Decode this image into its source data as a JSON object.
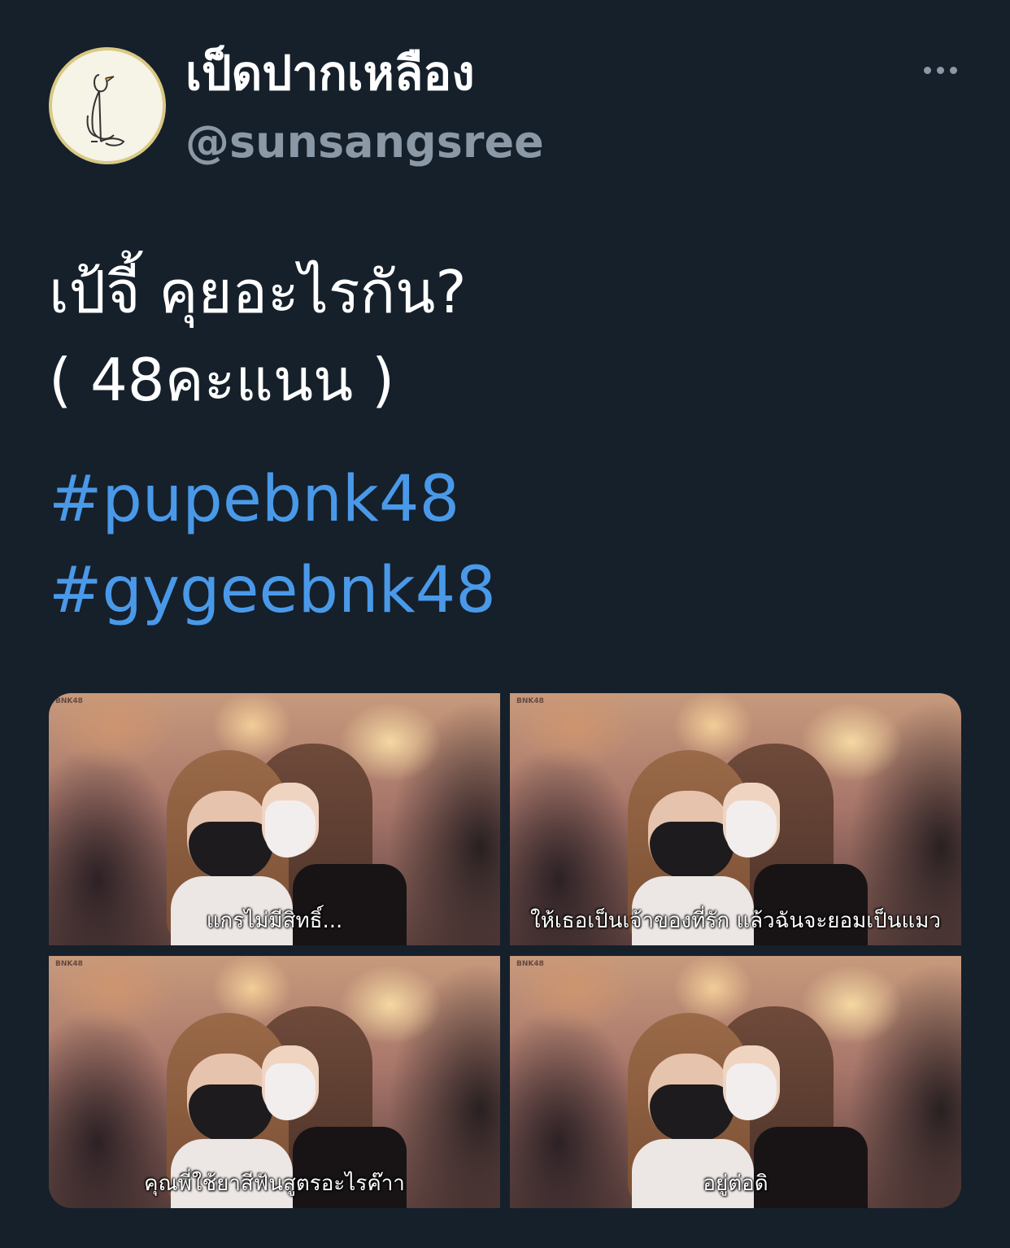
{
  "author": {
    "display_name": "เป็ดปากเหลือง",
    "handle": "@sunsangsree"
  },
  "tweet": {
    "line1": "เป้จี้ คุยอะไรกัน?",
    "line2": "( 48คะแนน )",
    "hashtags": [
      "#pupebnk48",
      "#gygeebnk48"
    ]
  },
  "media": [
    {
      "caption": "แกรไม่มีสิทธิ์...",
      "watermark": "BNK48"
    },
    {
      "caption": "ให้เธอเป็นเจ้าของที่รัก แล้วฉันจะยอมเป็นแมว",
      "watermark": "BNK48"
    },
    {
      "caption": "คุณพี่ใช้ยาสีฟันสูตรอะไรค๊าา",
      "watermark": "BNK48"
    },
    {
      "caption": "อยู่ต่อดิ",
      "watermark": "BNK48"
    }
  ],
  "colors": {
    "background": "#15202b",
    "hashtag": "#4a99e9",
    "secondary_text": "#8b98a5"
  },
  "icons": {
    "more": "more-horizontal-icon",
    "avatar": "duck-sketch-avatar"
  }
}
